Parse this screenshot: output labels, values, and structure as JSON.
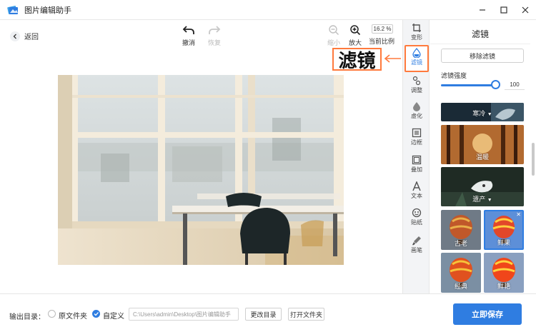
{
  "app": {
    "title": "图片编辑助手"
  },
  "toolbar": {
    "back_label": "返回",
    "undo_label": "撤消",
    "redo_label": "恢复",
    "zoom_out_label": "缩小",
    "zoom_in_label": "放大",
    "zoom_value": "16.2 %",
    "zoom_ratio_label": "当前比例"
  },
  "iconbar": {
    "items": [
      {
        "label": "变形",
        "icon": "crop-icon"
      },
      {
        "label": "滤镜",
        "icon": "filter-icon"
      },
      {
        "label": "调整",
        "icon": "adjust-icon"
      },
      {
        "label": "虚化",
        "icon": "blur-drop-icon"
      },
      {
        "label": "边框",
        "icon": "frame-icon"
      },
      {
        "label": "叠加",
        "icon": "overlay-icon"
      },
      {
        "label": "文本",
        "icon": "text-icon"
      },
      {
        "label": "贴纸",
        "icon": "sticker-icon"
      },
      {
        "label": "画笔",
        "icon": "brush-icon"
      }
    ],
    "active": "滤镜"
  },
  "callout": {
    "text": "滤镜"
  },
  "panel": {
    "title": "滤镜",
    "remove_label": "移除滤镜",
    "strength_label": "滤镜强度",
    "strength_value": "100",
    "strength_fraction": 1.0,
    "filters": [
      {
        "label": "寒冷"
      },
      {
        "label": "温暖"
      },
      {
        "label": "遗产"
      },
      {
        "label": "古老"
      },
      {
        "label": "鲜果"
      },
      {
        "label": "经典"
      },
      {
        "label": "鲜艳"
      }
    ]
  },
  "bottom": {
    "output_label": "输出目录：",
    "option_original": "原文件夹",
    "option_custom": "自定义",
    "path_value": "C:\\Users\\admin\\Desktop\\图片编辑助手",
    "change_dir_label": "更改目录",
    "open_folder_label": "打开文件夹",
    "save_label": "立即保存"
  },
  "colors": {
    "accent": "#2f7de1",
    "highlight": "#ff7a3d"
  }
}
